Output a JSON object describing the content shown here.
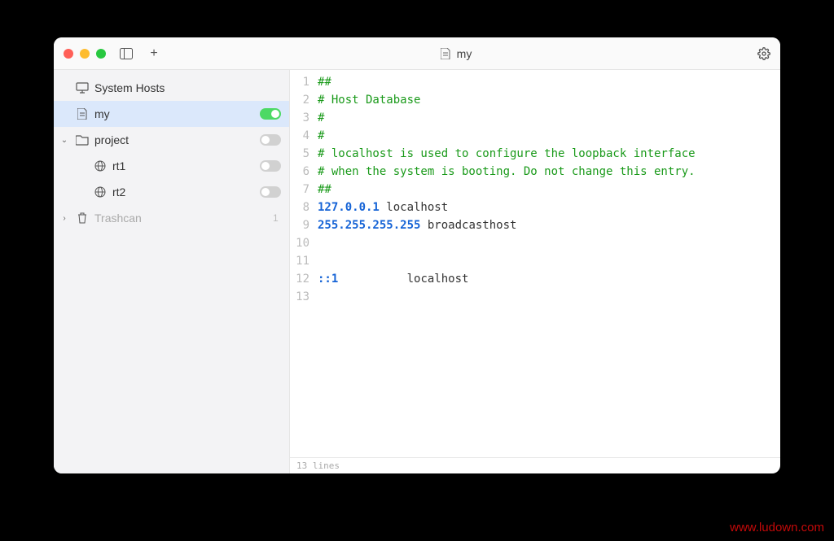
{
  "title": "my",
  "sidebar": {
    "system": "System Hosts",
    "my": "my",
    "project": "project",
    "rt1": "rt1",
    "rt2": "rt2",
    "trashcan": "Trashcan",
    "trashcount": "1"
  },
  "code": {
    "lines": [
      {
        "n": "1",
        "type": "comment",
        "text": "##"
      },
      {
        "n": "2",
        "type": "comment",
        "text": "# Host Database"
      },
      {
        "n": "3",
        "type": "comment",
        "text": "#"
      },
      {
        "n": "4",
        "type": "comment",
        "text": "#"
      },
      {
        "n": "5",
        "type": "comment",
        "text": "# localhost is used to configure the loopback interface"
      },
      {
        "n": "6",
        "type": "comment",
        "text": "# when the system is booting. Do not change this entry."
      },
      {
        "n": "7",
        "type": "comment",
        "text": "##"
      },
      {
        "n": "8",
        "type": "host",
        "ip": "127.0.0.1",
        "sep": " ",
        "host": "localhost"
      },
      {
        "n": "9",
        "type": "host",
        "ip": "255.255.255.255",
        "sep": " ",
        "host": "broadcasthost"
      },
      {
        "n": "10",
        "type": "blank",
        "text": ""
      },
      {
        "n": "11",
        "type": "blank",
        "text": ""
      },
      {
        "n": "12",
        "type": "host",
        "ip": "::1",
        "sep": "          ",
        "host": "localhost"
      },
      {
        "n": "13",
        "type": "blank",
        "text": ""
      }
    ]
  },
  "status": "13 lines",
  "watermark": "www.ludown.com"
}
